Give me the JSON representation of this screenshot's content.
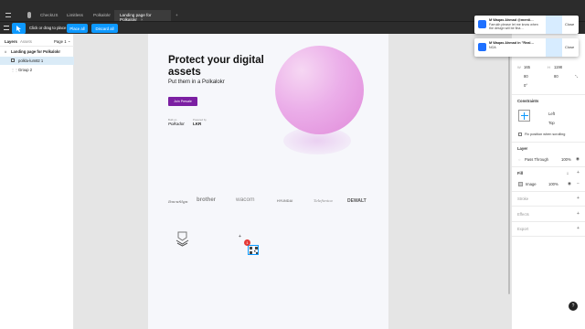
{
  "tabs": [
    {
      "label": "CheckUS"
    },
    {
      "label": "Limitless"
    },
    {
      "label": "Polkalokr"
    },
    {
      "label": "Landing page for Polkalokr",
      "active": true,
      "close": "×"
    },
    {
      "label": "+"
    }
  ],
  "toolbar": {
    "hint": "Click or drag to place",
    "place_all": "Place all",
    "discard_all": "Discard all"
  },
  "left_panel": {
    "tab_layers": "Layers",
    "tab_assets": "Assets",
    "page": "Page 1",
    "layers": [
      "Landing page for Polkalokr",
      "polkla-lum82 1",
      "Group 2"
    ]
  },
  "frame": {
    "headline_line1": "Protect your digital",
    "headline_line2": "assets",
    "subheadline": "Put them in a Polkalokr",
    "cta": "Join Presale",
    "built_on_label": "Built on",
    "built_on_value": "Polkadot",
    "powered_label": "Powered by",
    "powered_value": "LKR",
    "brands": [
      "DocuSign",
      "brother",
      "wacom",
      "HYUNDAI",
      "Telefonica",
      "DEWALT"
    ]
  },
  "badge": {
    "count": "1"
  },
  "right_panel": {
    "w_label": "W",
    "w_value": "165",
    "h_label": "H",
    "h_value": "1198",
    "x_value": "80",
    "y_value": "80",
    "rotation": "0°",
    "constraints_title": "Constraints",
    "constraint_h": "Left",
    "constraint_v": "Top",
    "fix_label": "Fix position when scrolling",
    "layer_title": "Layer",
    "blend": "Pass Through",
    "layer_opacity": "100%",
    "fill_title": "Fill",
    "fill_type": "Image",
    "fill_opacity": "100%",
    "stroke_title": "Stroke",
    "effects_title": "Effects",
    "export_title": "Export"
  },
  "toasts": [
    {
      "title": "M Waqas Ahmad @menti…",
      "body": "Farrukh please let me know when the design will be fina…",
      "close": "Close"
    },
    {
      "title": "M Waqas Ahmad in \"Real…",
      "body": "NOA",
      "close": "Close"
    }
  ],
  "help": "?",
  "colors": {
    "accent": "#0d99ff",
    "cta": "#7b1fa2",
    "orb": "#e9a7e8"
  }
}
